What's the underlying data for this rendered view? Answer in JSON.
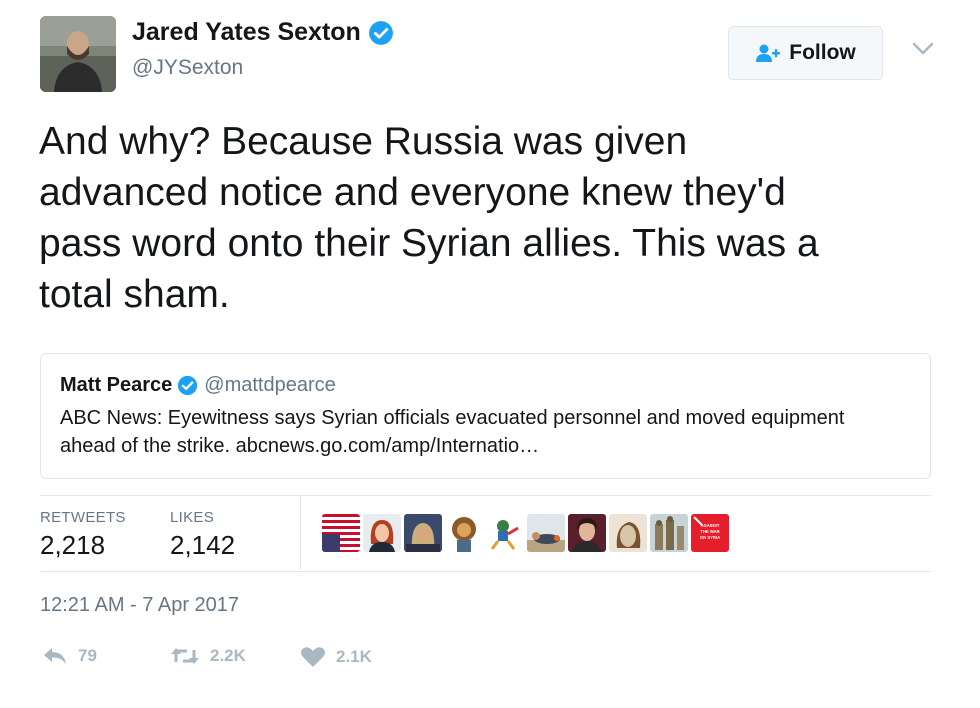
{
  "author": {
    "name": "Jared Yates Sexton",
    "handle": "@JYSexton",
    "avatar_icon": "avatar-photo-icon",
    "verified_icon": "verified-badge-icon"
  },
  "follow_button": {
    "label": "Follow",
    "icon": "follow-person-plus-icon"
  },
  "menu_icon": "chevron-down-icon",
  "tweet_text": "And why? Because Russia was given\nadvanced notice and everyone knew they'd\npass word onto their Syrian allies. This was a\ntotal sham.",
  "quoted_tweet": {
    "name": "Matt Pearce",
    "handle": "@mattdpearce",
    "text": "ABC News: Eyewitness says Syrian officials evacuated personnel and moved equipment ahead of the strike. abcnews.go.com/amp/Internatio…"
  },
  "stats": {
    "retweets_label": "RETWEETS",
    "retweets_value": "2,218",
    "likes_label": "LIKES",
    "likes_value": "2,142"
  },
  "likers": [
    {
      "icon": "upside-down-flag-icon"
    },
    {
      "icon": "woman-red-hair-avatar-icon"
    },
    {
      "icon": "person-with-headscarf-avatar-icon"
    },
    {
      "icon": "lion-avatar-icon"
    },
    {
      "icon": "cartoon-character-avatar-icon"
    },
    {
      "icon": "reclining-figure-avatar-icon"
    },
    {
      "icon": "portrait-avatar-icon"
    },
    {
      "icon": "horse-avatar-icon"
    },
    {
      "icon": "statues-avatar-icon"
    },
    {
      "icon": "red-banner-avatar-icon",
      "text": "AGAINST THE WAR ON SYRIA"
    }
  ],
  "timestamp": "12:21 AM - 7 Apr 2017",
  "actions": {
    "reply": {
      "icon": "reply-icon",
      "count": "79"
    },
    "retweet": {
      "icon": "retweet-icon",
      "count": "2.2K"
    },
    "like": {
      "icon": "heart-icon",
      "count": "2.1K"
    }
  },
  "colors": {
    "verified_blue": "#1da1f2",
    "text_primary": "#14171a",
    "text_secondary": "#657786",
    "action_gray": "#aab8c2",
    "border": "#e1e8ed"
  }
}
